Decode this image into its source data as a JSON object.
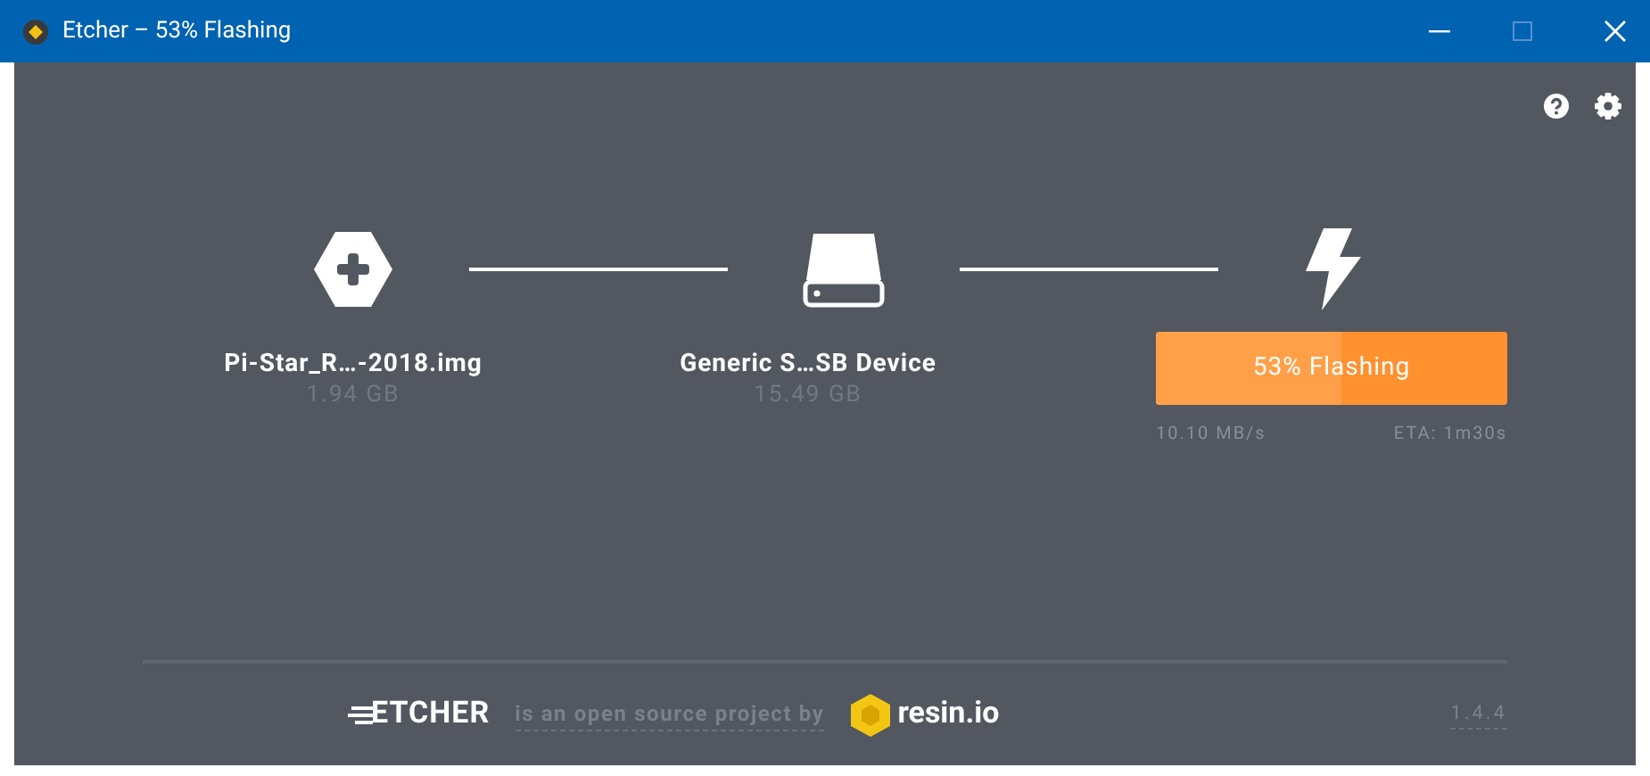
{
  "window": {
    "title": "Etcher – 53% Flashing"
  },
  "steps": [
    {
      "kind": "image",
      "name": "Pi-Star_R…-2018.img",
      "size": "1.94 GB"
    },
    {
      "kind": "drive",
      "name": "Generic S…SB Device",
      "size": "15.49 GB"
    },
    {
      "kind": "flash",
      "label": "53% Flashing",
      "level": 0.53,
      "speed": "10.10 MB/s",
      "eta": "ETA: 1m30s"
    }
  ],
  "footer": {
    "logo": "ETCHER",
    "tagline": "is an open source project by",
    "company": "resin.io",
    "version": "1.4.4"
  }
}
